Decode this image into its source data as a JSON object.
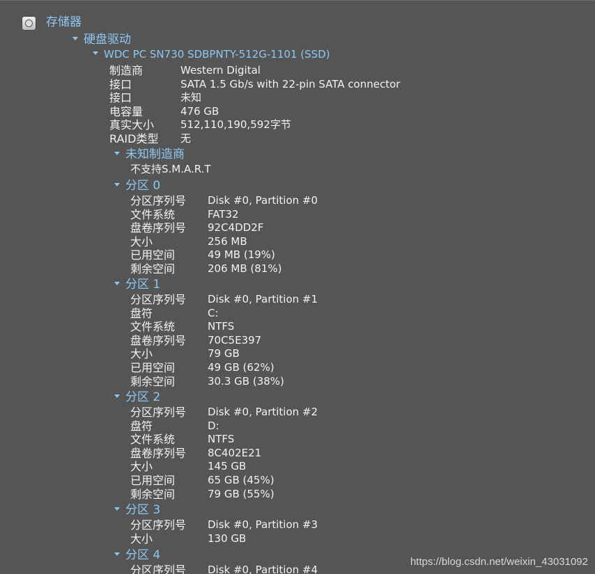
{
  "storage": {
    "title": "存储器",
    "icon": "hard-disk-icon"
  },
  "drives": {
    "title": "硬盘驱动",
    "expand_icon": "triangle-down-icon"
  },
  "disk": {
    "name": "WDC PC SN730 SDBPNTY-512G-1101 (SSD)",
    "properties": [
      {
        "label": "制造商",
        "value": "Western Digital"
      },
      {
        "label": "接口",
        "value": "SATA 1.5 Gb/s with 22-pin SATA connector"
      },
      {
        "label": "接口",
        "value": "未知"
      },
      {
        "label": "电容量",
        "value": "476 GB"
      },
      {
        "label": "真实大小",
        "value": "512,110,190,592字节"
      },
      {
        "label": "RAID类型",
        "value": "无"
      }
    ]
  },
  "smart": {
    "title": "未知制造商",
    "text": "不支持S.M.A.R.T"
  },
  "partitions": [
    {
      "title": "分区 0",
      "rows": [
        {
          "label": "分区序列号",
          "value": "Disk #0, Partition #0"
        },
        {
          "label": "文件系统",
          "value": "FAT32"
        },
        {
          "label": "盘卷序列号",
          "value": "92C4DD2F"
        },
        {
          "label": "大小",
          "value": "256 MB"
        },
        {
          "label": "已用空间",
          "value": "49 MB (19%)"
        },
        {
          "label": "剩余空间",
          "value": "206 MB (81%)"
        }
      ]
    },
    {
      "title": "分区 1",
      "rows": [
        {
          "label": "分区序列号",
          "value": "Disk #0, Partition #1"
        },
        {
          "label": "盘符",
          "value": "C:"
        },
        {
          "label": "文件系统",
          "value": "NTFS"
        },
        {
          "label": "盘卷序列号",
          "value": "70C5E397"
        },
        {
          "label": "大小",
          "value": "79 GB"
        },
        {
          "label": "已用空间",
          "value": "49 GB (62%)"
        },
        {
          "label": "剩余空间",
          "value": "30.3 GB (38%)"
        }
      ]
    },
    {
      "title": "分区 2",
      "rows": [
        {
          "label": "分区序列号",
          "value": "Disk #0, Partition #2"
        },
        {
          "label": "盘符",
          "value": "D:"
        },
        {
          "label": "文件系统",
          "value": "NTFS"
        },
        {
          "label": "盘卷序列号",
          "value": "8C402E21"
        },
        {
          "label": "大小",
          "value": "145 GB"
        },
        {
          "label": "已用空间",
          "value": "65 GB (45%)"
        },
        {
          "label": "剩余空间",
          "value": "79 GB (55%)"
        }
      ]
    },
    {
      "title": "分区 3",
      "rows": [
        {
          "label": "分区序列号",
          "value": "Disk #0, Partition #3"
        },
        {
          "label": "大小",
          "value": "130 GB"
        }
      ]
    },
    {
      "title": "分区 4",
      "rows": [
        {
          "label": "分区序列号",
          "value": "Disk #0, Partition #4"
        }
      ]
    }
  ],
  "watermark": "https://blog.csdn.net/weixin_43031092",
  "colors": {
    "background": "#555555",
    "heading": "#8ec8f2",
    "text": "#f2f2f2"
  }
}
